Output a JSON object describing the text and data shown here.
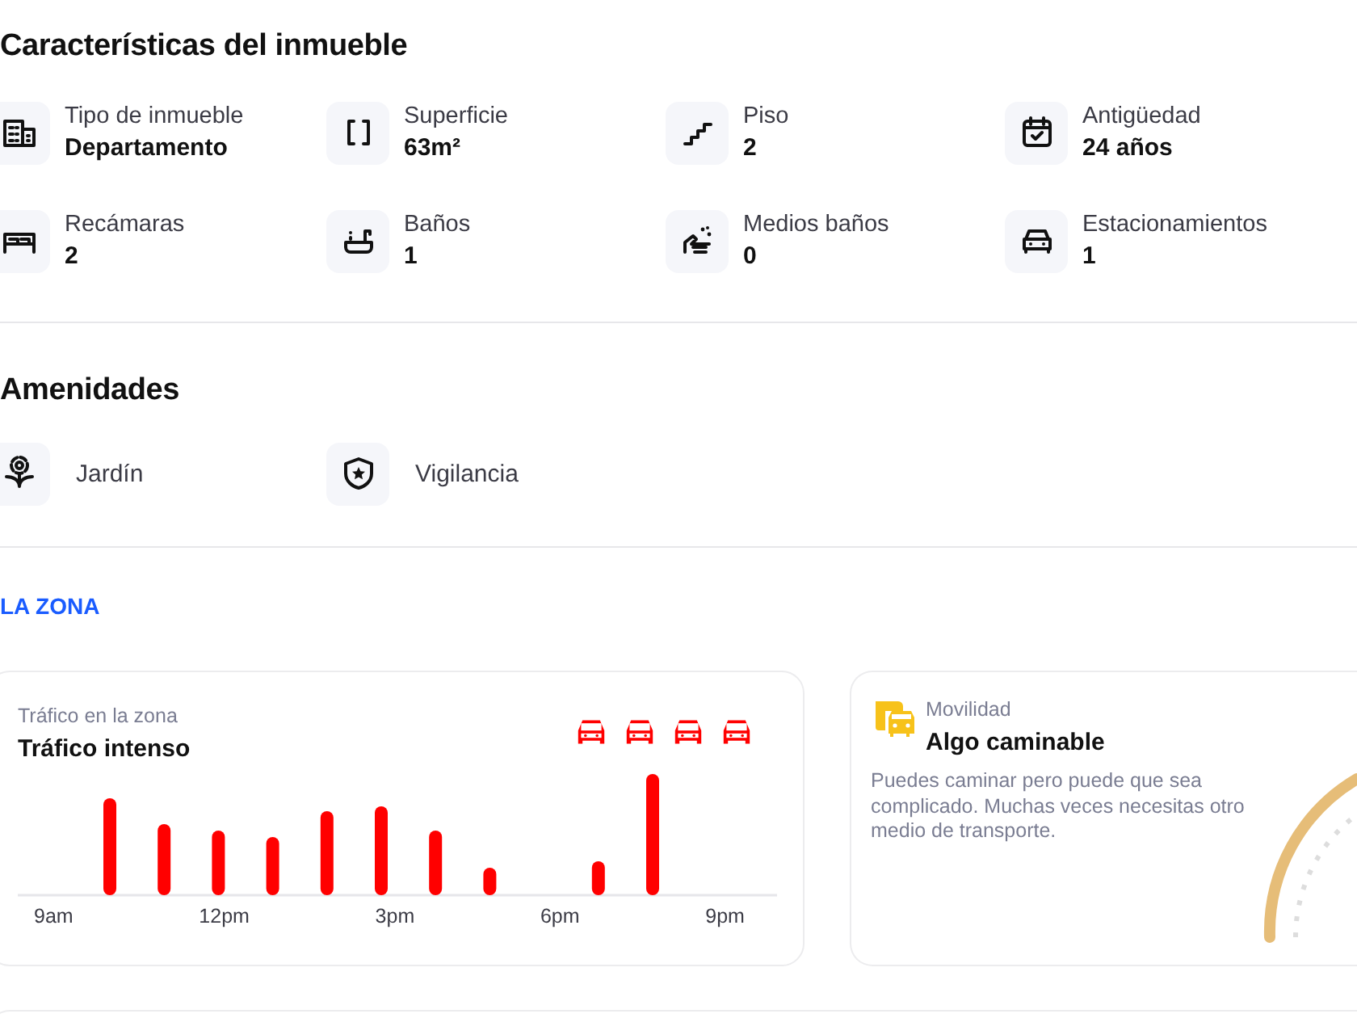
{
  "features": {
    "title": "Características del inmueble",
    "items": [
      {
        "label": "Tipo de inmueble",
        "value": "Departamento"
      },
      {
        "label": "Superficie",
        "value": "63m²"
      },
      {
        "label": "Piso",
        "value": "2"
      },
      {
        "label": "Antigüedad",
        "value": "24 años"
      },
      {
        "label": "Recámaras",
        "value": "2"
      },
      {
        "label": "Baños",
        "value": "1"
      },
      {
        "label": "Medios baños",
        "value": "0"
      },
      {
        "label": "Estacionamientos",
        "value": "1"
      }
    ]
  },
  "amenities": {
    "title": "Amenidades",
    "items": [
      "Jardín",
      "Vigilancia"
    ]
  },
  "zone": {
    "title": "LA ZONA",
    "traffic": {
      "caption": "Tráfico en la zona",
      "title": "Tráfico intenso",
      "hours": [
        "9am",
        "12pm",
        "3pm",
        "6pm",
        "9pm"
      ]
    },
    "mobility": {
      "caption": "Movilidad",
      "title": "Algo caminable",
      "description": "Puedes caminar pero puede que sea complicado. Muchas veces necesitas otro medio de transporte."
    }
  }
}
